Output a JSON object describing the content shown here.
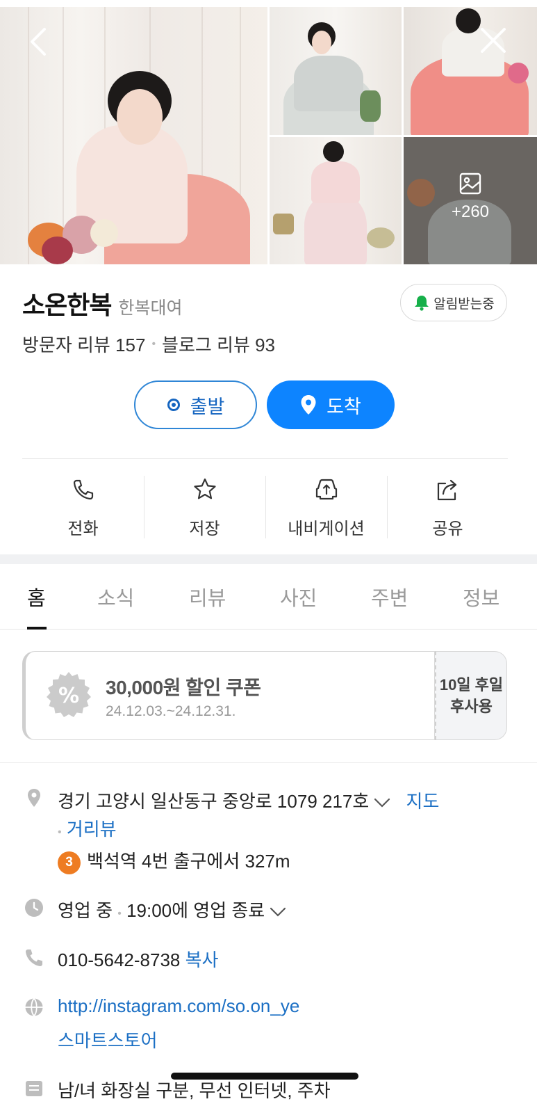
{
  "gallery": {
    "more_count": "+260"
  },
  "place": {
    "name": "소온한복",
    "category": "한복대여",
    "alarm_label": "알림받는중",
    "visitor_reviews": "방문자 리뷰 157",
    "blog_reviews": "블로그 리뷰 93"
  },
  "route": {
    "start_label": "출발",
    "end_label": "도착"
  },
  "actions": [
    {
      "label": "전화",
      "icon": "phone-icon"
    },
    {
      "label": "저장",
      "icon": "star-icon"
    },
    {
      "label": "내비게이션",
      "icon": "car-navigation-icon"
    },
    {
      "label": "공유",
      "icon": "share-icon"
    }
  ],
  "tabs": [
    {
      "label": "홈",
      "active": true
    },
    {
      "label": "소식"
    },
    {
      "label": "리뷰"
    },
    {
      "label": "사진"
    },
    {
      "label": "주변"
    },
    {
      "label": "정보"
    }
  ],
  "coupon": {
    "badge": "%",
    "title": "30,000원 할인 쿠폰",
    "period": "24.12.03.~24.12.31.",
    "side_line1": "10일 후일",
    "side_line2": "후사용"
  },
  "info": {
    "address": "경기 고양시 일산동구 중앙로 1079 217호",
    "map_link": "지도",
    "street_view_link": "거리뷰",
    "subway_line": "3",
    "subway_text": "백석역 4번 출구에서 327m",
    "hours_status": "영업 중",
    "hours_detail": "19:00에 영업 종료",
    "phone": "010-5642-8738",
    "copy_link": "복사",
    "website": "http://instagram.com/so.on_ye",
    "store_link": "스마트스토어",
    "amenities": "남/녀 화장실 구분, 무선 인터넷, 주차"
  },
  "colors": {
    "accent": "#0d84ff",
    "link": "#1b6fc4",
    "alarm_bell": "#16b04a",
    "subway_line3": "#ee7c22"
  }
}
